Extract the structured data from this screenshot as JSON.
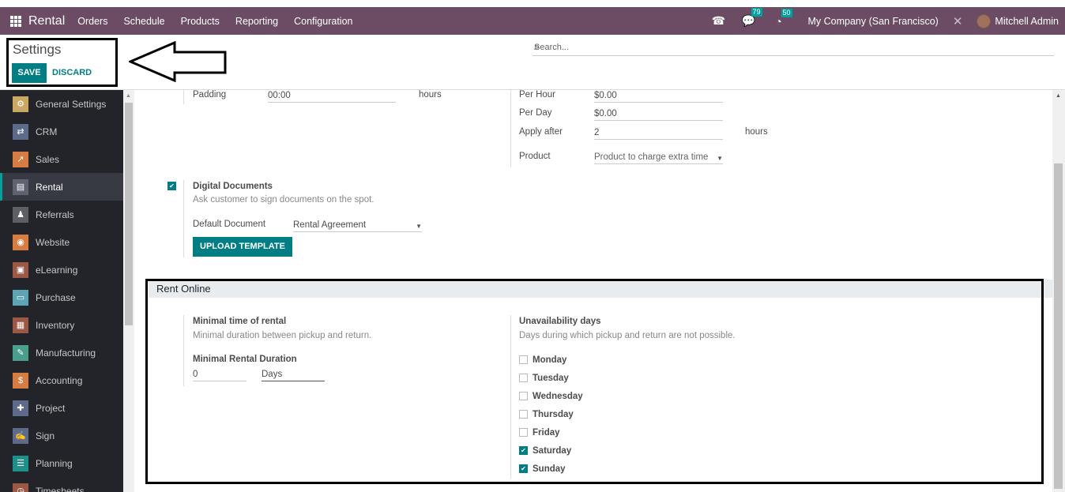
{
  "navbar": {
    "app_name": "Rental",
    "menu": [
      "Orders",
      "Schedule",
      "Products",
      "Reporting",
      "Configuration"
    ],
    "messages_count": "79",
    "activities_count": "50",
    "company": "My Company (San Francisco)",
    "user": "Mitchell Admin",
    "colors": {
      "navbar": "#6b4c64",
      "badge": "#00a09d"
    }
  },
  "control_panel": {
    "title": "Settings",
    "save_label": "SAVE",
    "discard_label": "DISCARD",
    "search_placeholder": "Search..."
  },
  "sidebar": {
    "items": [
      {
        "label": "General Settings",
        "icon": "gear-icon",
        "color": "#c8a863"
      },
      {
        "label": "CRM",
        "icon": "handshake-icon",
        "color": "#5c6b8a"
      },
      {
        "label": "Sales",
        "icon": "chart-icon",
        "color": "#d67d43"
      },
      {
        "label": "Rental",
        "icon": "rental-icon",
        "color": "#5f6370",
        "active": true
      },
      {
        "label": "Referrals",
        "icon": "referrals-icon",
        "color": "#5d5e66"
      },
      {
        "label": "Website",
        "icon": "globe-icon",
        "color": "#d67d43"
      },
      {
        "label": "eLearning",
        "icon": "elearning-icon",
        "color": "#9a5846"
      },
      {
        "label": "Purchase",
        "icon": "card-icon",
        "color": "#5ea5b3"
      },
      {
        "label": "Inventory",
        "icon": "box-icon",
        "color": "#9a5846"
      },
      {
        "label": "Manufacturing",
        "icon": "wrench-icon",
        "color": "#4b9e8c"
      },
      {
        "label": "Accounting",
        "icon": "invoice-icon",
        "color": "#d67d43"
      },
      {
        "label": "Project",
        "icon": "puzzle-icon",
        "color": "#5c6b8a"
      },
      {
        "label": "Sign",
        "icon": "sign-icon",
        "color": "#5c6b8a"
      },
      {
        "label": "Planning",
        "icon": "planning-icon",
        "color": "#1f8f8a"
      },
      {
        "label": "Timesheets",
        "icon": "timesheet-icon",
        "color": "#9a5846"
      }
    ]
  },
  "content": {
    "padding_label": "Padding",
    "padding_value": "00:00",
    "padding_unit": "hours",
    "per_hour_label": "Per Hour",
    "per_hour_value": "$0.00",
    "per_day_label": "Per Day",
    "per_day_value": "$0.00",
    "apply_after_label": "Apply after",
    "apply_after_value": "2",
    "apply_after_unit": "hours",
    "product_label": "Product",
    "product_placeholder": "Product to charge extra time",
    "digital_docs": {
      "checked": true,
      "title": "Digital Documents",
      "description": "Ask customer to sign documents on the spot.",
      "default_doc_label": "Default Document",
      "default_doc_value": "Rental Agreement",
      "upload_label": "UPLOAD TEMPLATE"
    },
    "rent_online": {
      "section_title": "Rent Online",
      "min_time_title": "Minimal time of rental",
      "min_time_desc": "Minimal duration between pickup and return.",
      "min_duration_label": "Minimal Rental Duration",
      "min_duration_value": "0",
      "min_duration_unit": "Days",
      "unavail_title": "Unavailability days",
      "unavail_desc": "Days during which pickup and return are not possible.",
      "days": [
        {
          "label": "Monday",
          "checked": false
        },
        {
          "label": "Tuesday",
          "checked": false
        },
        {
          "label": "Wednesday",
          "checked": false
        },
        {
          "label": "Thursday",
          "checked": false
        },
        {
          "label": "Friday",
          "checked": false
        },
        {
          "label": "Saturday",
          "checked": true
        },
        {
          "label": "Sunday",
          "checked": true
        }
      ]
    }
  }
}
